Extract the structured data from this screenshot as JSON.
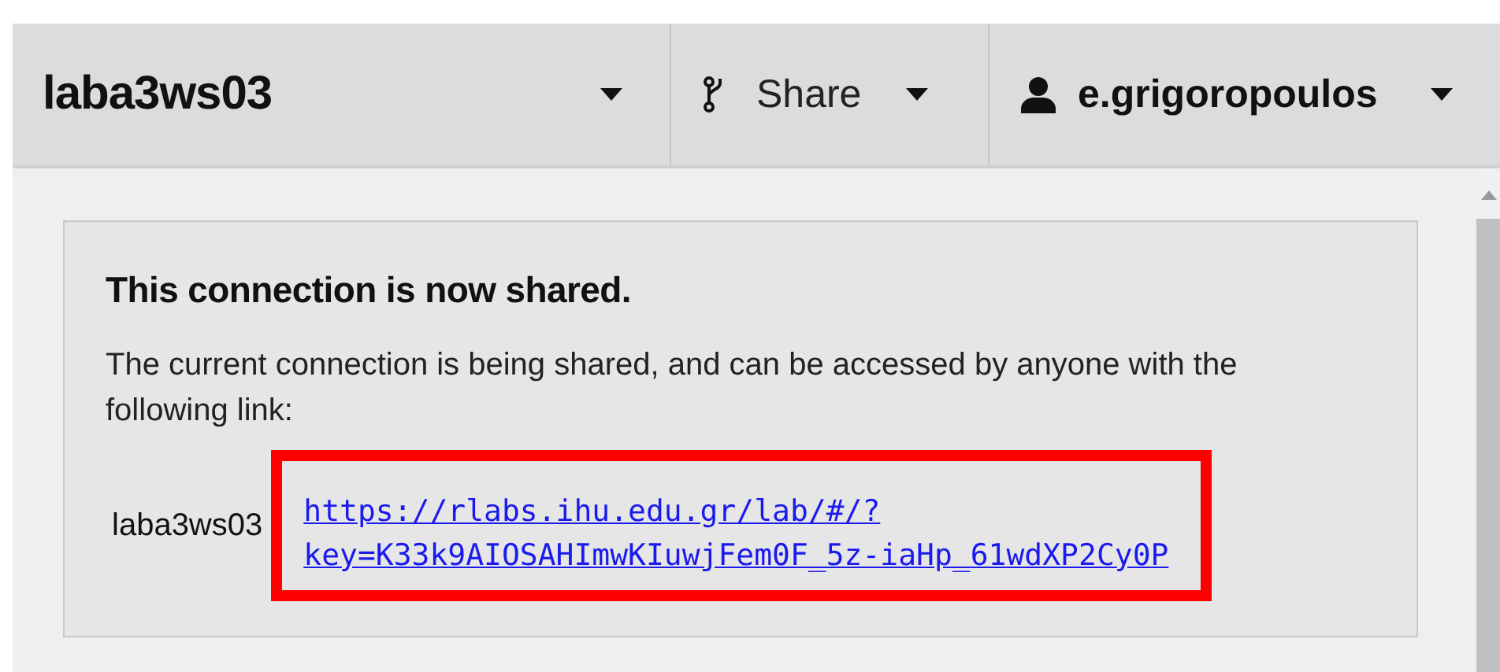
{
  "header": {
    "connection_name": "laba3ws03",
    "share_label": "Share",
    "user_name": "e.grigoropoulos"
  },
  "notification": {
    "title": "This connection is now shared.",
    "message": "The current connection is being shared, and can be accessed by anyone with the following link:",
    "links": [
      {
        "name": "laba3ws03",
        "url_lines": [
          "https://rlabs.ihu.edu.gr/lab/#/?",
          "key=K33k9AIOSAHImwKIuwjFem0F_5z-iaHp_61wdXP2Cy0P"
        ]
      }
    ]
  }
}
